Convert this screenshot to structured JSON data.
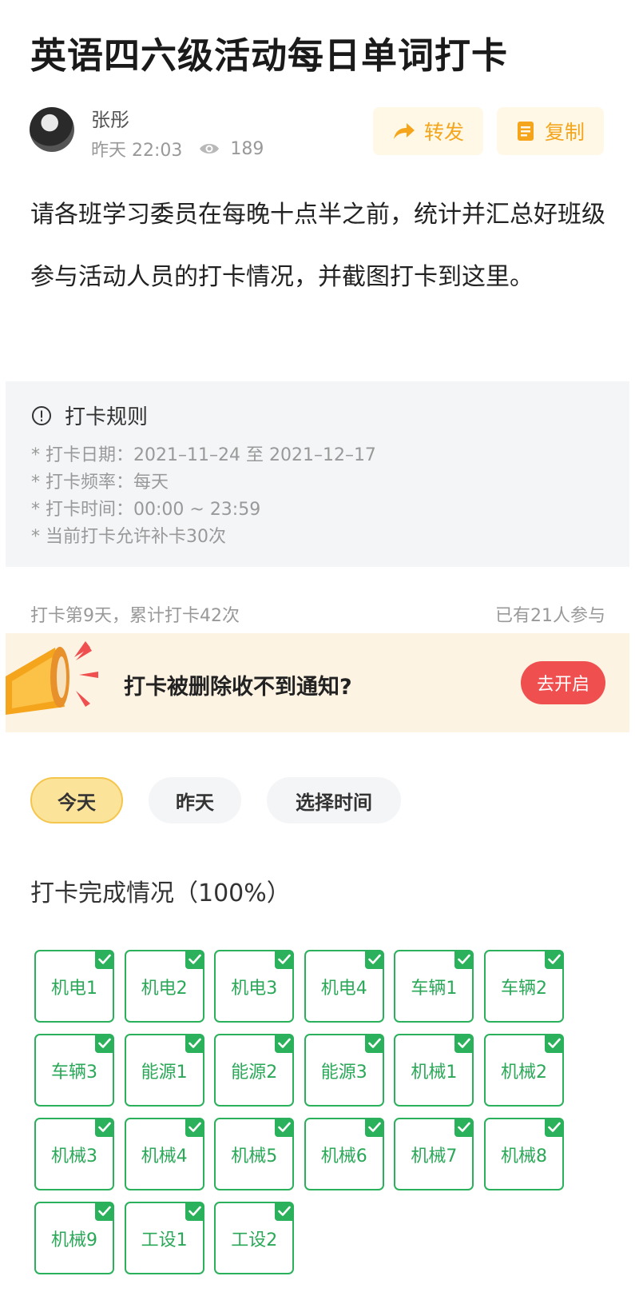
{
  "title": "英语四六级活动每日单词打卡",
  "author": {
    "name": "张彤",
    "time": "昨天 22:03",
    "views": "189"
  },
  "actions": {
    "share_label": "转发",
    "copy_label": "复制"
  },
  "description": "请各班学习委员在每晚十点半之前，统计并汇总好班级参与活动人员的打卡情况，并截图打卡到这里。",
  "rules": {
    "heading": "打卡规则",
    "items": [
      "* 打卡日期：2021–11–24 至 2021–12–17",
      "* 打卡频率：每天",
      "* 打卡时间：00:00 ~ 23:59",
      "* 当前打卡允许补卡30次"
    ]
  },
  "stats": {
    "left": "打卡第9天，累计打卡42次",
    "right": "已有21人参与"
  },
  "banner": {
    "text": "打卡被删除收不到通知?",
    "button": "去开启"
  },
  "tabs": [
    "今天",
    "昨天",
    "选择时间"
  ],
  "completion": {
    "title": "打卡完成情况（100%）",
    "classes": [
      "机电1",
      "机电2",
      "机电3",
      "机电4",
      "车辆1",
      "车辆2",
      "车辆3",
      "能源1",
      "能源2",
      "能源3",
      "机械1",
      "机械2",
      "机械3",
      "机械4",
      "机械5",
      "机械6",
      "机械7",
      "机械8",
      "机械9",
      "工设1",
      "工设2"
    ]
  },
  "colors": {
    "accent_orange": "#f4a51c",
    "check_green": "#2bb15c",
    "alert_red": "#ef4f4f",
    "active_tab": "#fbe39a"
  }
}
